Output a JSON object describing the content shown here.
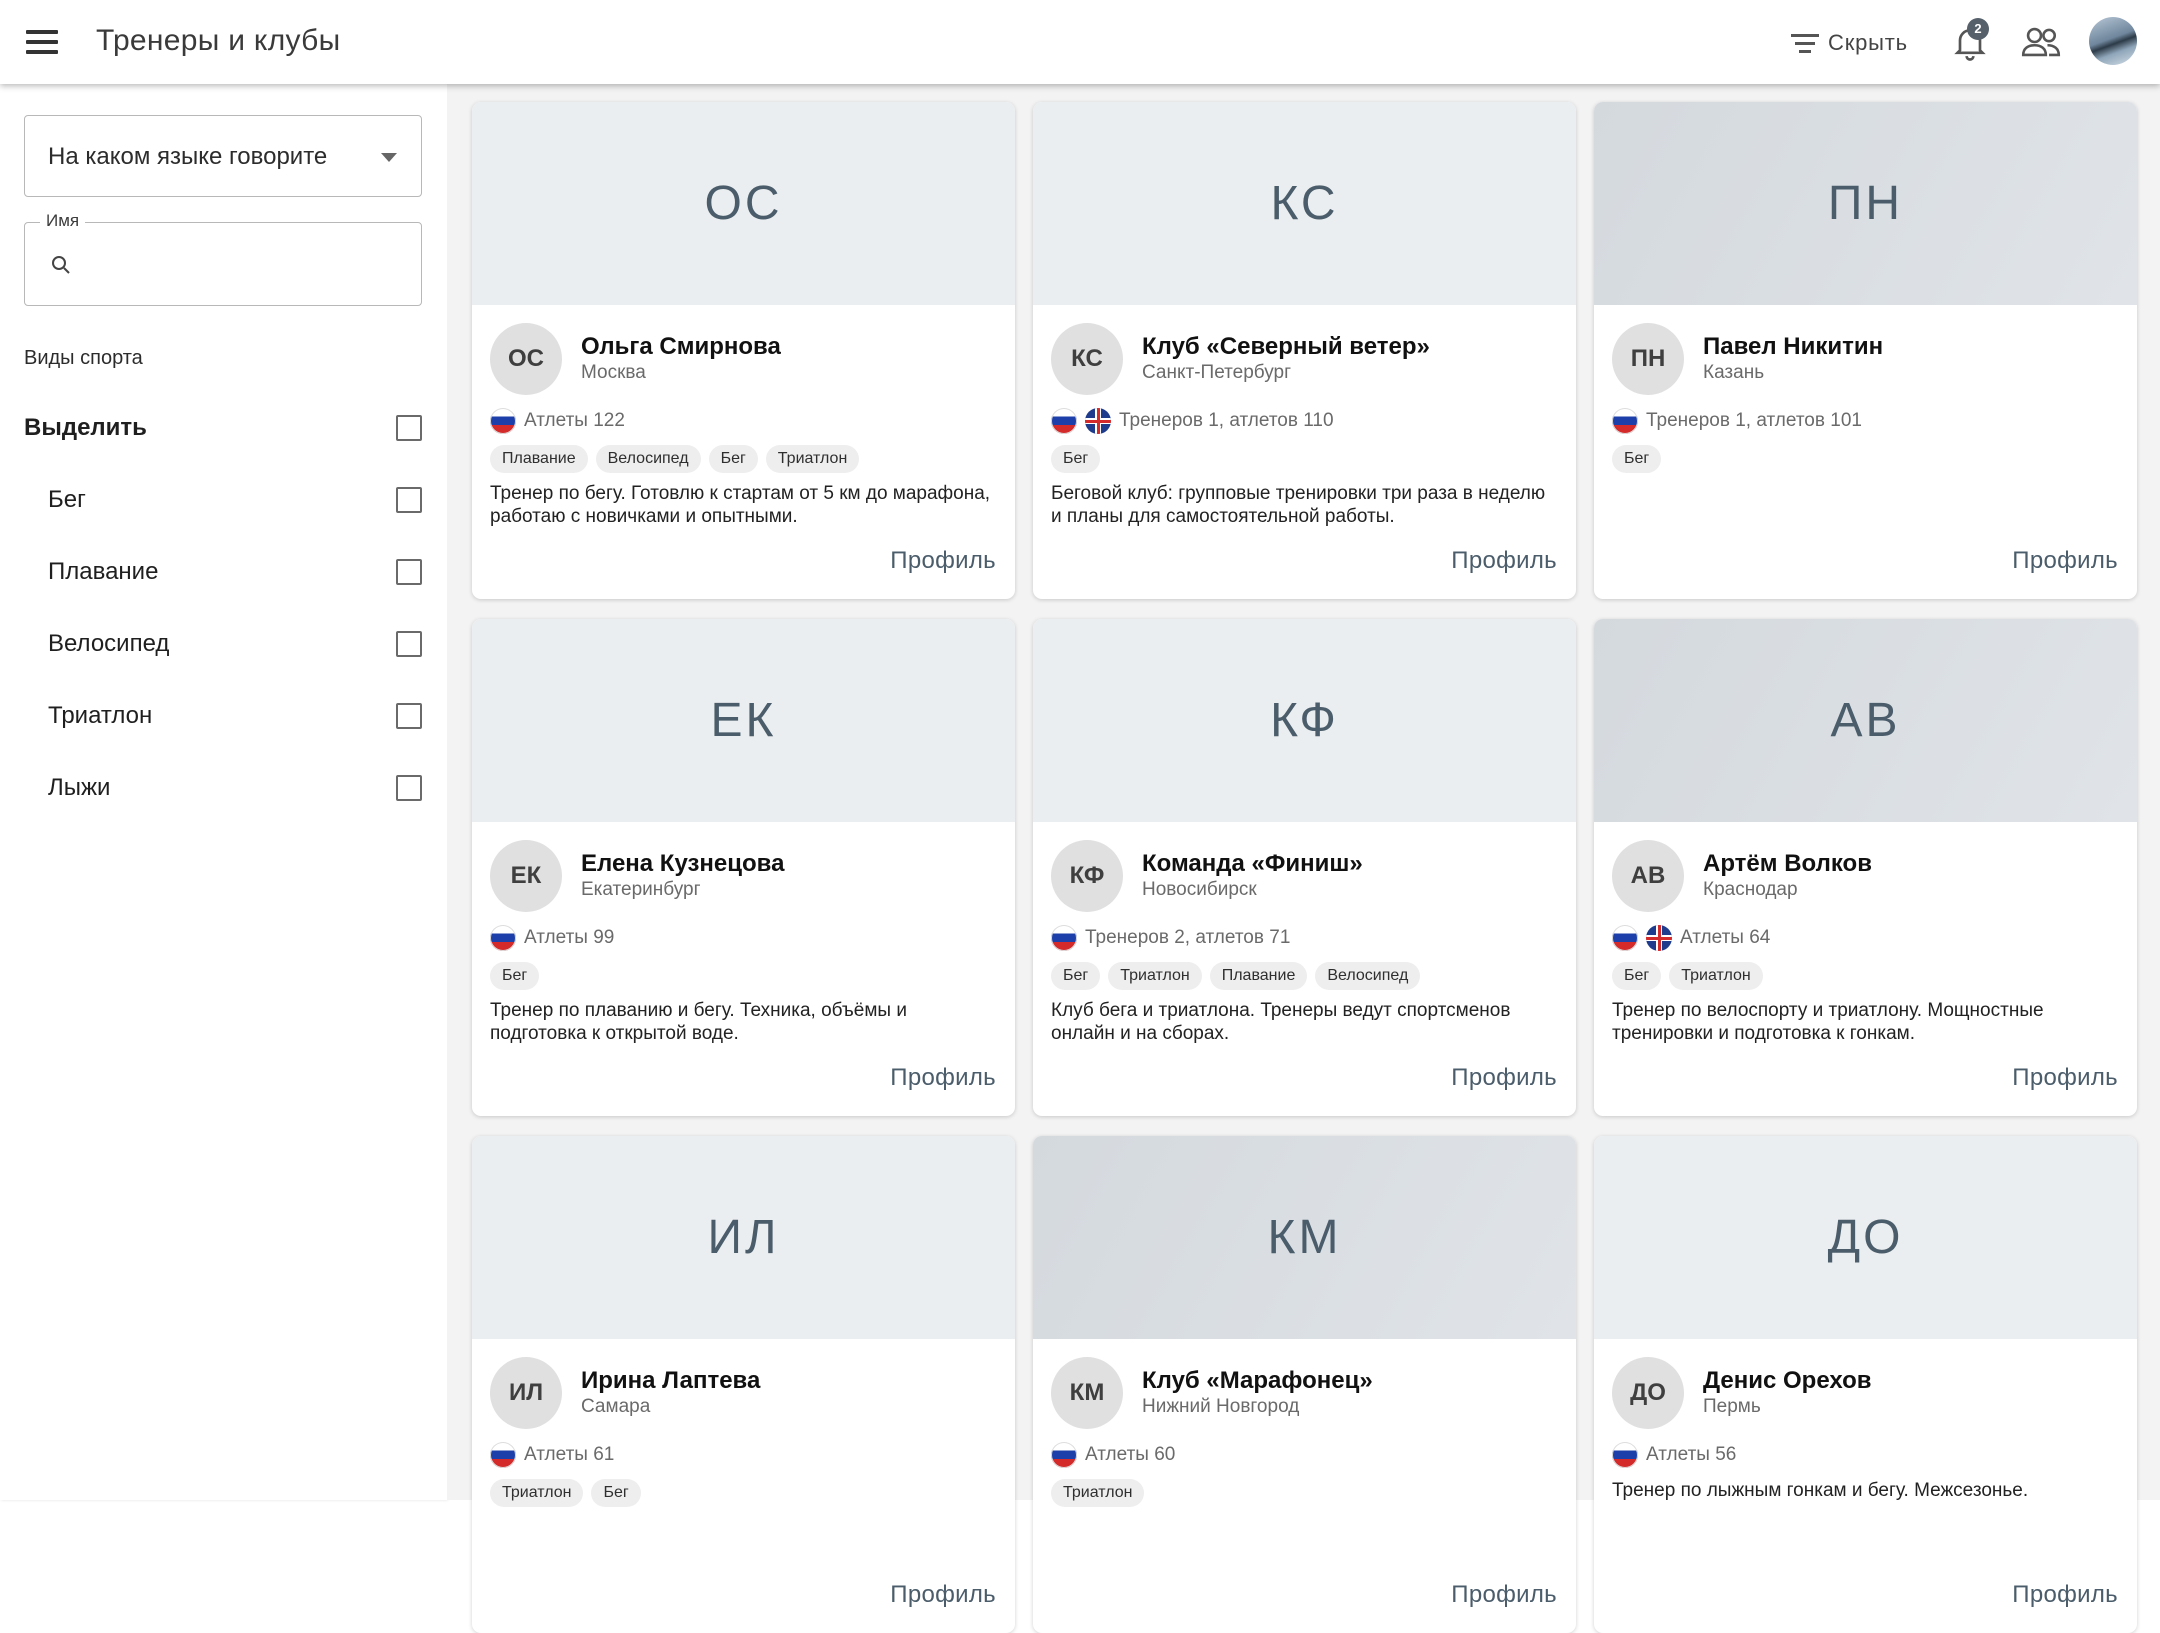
{
  "header": {
    "title": "Тренеры и клубы",
    "hide_label": "Скрыть",
    "notifications_count": "2"
  },
  "sidebar": {
    "language_select": "На каком языке говорите",
    "name_label": "Имя",
    "name_value": "",
    "sports_title": "Виды спорта",
    "select_all": "Выделить",
    "sports": [
      "Бег",
      "Плавание",
      "Велосипед",
      "Триатлон",
      "Лыжи"
    ]
  },
  "cards": [
    {
      "initials": "ОС",
      "name": "Ольга Смирнова",
      "city": "Москва",
      "flags": [
        "ru"
      ],
      "stats": "Атлеты 122",
      "tags": [
        "Плавание",
        "Велосипед",
        "Бег",
        "Триатлон"
      ],
      "description": "Тренер по бегу. Готовлю к стартам от 5 км до марафона, работаю с новичками и опытными.",
      "profile": "Профиль",
      "cover": "light"
    },
    {
      "initials": "КС",
      "name": "Клуб «Северный ветер»",
      "city": "Санкт-Петербург",
      "flags": [
        "ru",
        "gb"
      ],
      "stats": "Тренеров 1, атлетов 110",
      "tags": [
        "Бег"
      ],
      "description": "Беговой клуб: групповые тренировки три раза в неделю и планы для самостоятельной работы.",
      "profile": "Профиль",
      "cover": "light"
    },
    {
      "initials": "ПН",
      "name": "Павел Никитин",
      "city": "Казань",
      "flags": [
        "ru"
      ],
      "stats": "Тренеров 1, атлетов 101",
      "tags": [
        "Бег"
      ],
      "description": "",
      "profile": "Профиль",
      "cover": "dark"
    },
    {
      "initials": "ЕК",
      "name": "Елена Кузнецова",
      "city": "Екатеринбург",
      "flags": [
        "ru"
      ],
      "stats": "Атлеты 99",
      "tags": [
        "Бег"
      ],
      "description": "Тренер по плаванию и бегу. Техника, объёмы и подготовка к открытой воде.",
      "profile": "Профиль",
      "cover": "light"
    },
    {
      "initials": "КФ",
      "name": "Команда «Финиш»",
      "city": "Новосибирск",
      "flags": [
        "ru"
      ],
      "stats": "Тренеров 2, атлетов 71",
      "tags": [
        "Бег",
        "Триатлон",
        "Плавание",
        "Велосипед"
      ],
      "description": "Клуб бега и триатлона. Тренеры ведут спортсменов онлайн и на сборах.",
      "profile": "Профиль",
      "cover": "light"
    },
    {
      "initials": "АВ",
      "name": "Артём Волков",
      "city": "Краснодар",
      "flags": [
        "ru",
        "gb"
      ],
      "stats": "Атлеты 64",
      "tags": [
        "Бег",
        "Триатлон"
      ],
      "description": "Тренер по велоспорту и триатлону. Мощностные тренировки и подготовка к гонкам.",
      "profile": "Профиль",
      "cover": "dark"
    },
    {
      "initials": "ИЛ",
      "name": "Ирина Лаптева",
      "city": "Самара",
      "flags": [
        "ru"
      ],
      "stats": "Атлеты 61",
      "tags": [
        "Триатлон",
        "Бег"
      ],
      "description": "",
      "profile": "Профиль",
      "cover": "light"
    },
    {
      "initials": "КМ",
      "name": "Клуб «Марафонец»",
      "city": "Нижний Новгород",
      "flags": [
        "ru"
      ],
      "stats": "Атлеты 60",
      "tags": [
        "Триатлон"
      ],
      "description": "",
      "profile": "Профиль",
      "cover": "dark"
    },
    {
      "initials": "ДО",
      "name": "Денис Орехов",
      "city": "Пермь",
      "flags": [
        "ru"
      ],
      "stats": "Атлеты 56",
      "tags": [],
      "description": "Тренер по лыжным гонкам и бегу. Межсезонье.",
      "profile": "Профиль",
      "cover": "light"
    }
  ]
}
